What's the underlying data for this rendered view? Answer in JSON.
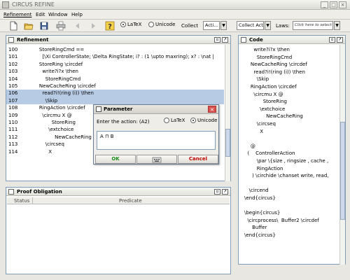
{
  "window": {
    "title": "CIRCUS REFINE"
  },
  "menu": [
    "Refinement",
    "Edit",
    "Window",
    "Help"
  ],
  "toolbar": {
    "latex_label": "LaTeX",
    "unicode_label": "Unicode",
    "selected_encoding": "LaTeX",
    "collect_label": "Collect",
    "action_combo": "Acti...",
    "collect_action_combo": "Collect Act...",
    "laws_label": "Laws:",
    "laws_placeholder": "Click here to select"
  },
  "refinement_panel": {
    "title": "Refinement",
    "lines": [
      {
        "num": "100",
        "text": "    StoreRingCmd =="
      },
      {
        "num": "101",
        "text": "      [\\Xi ControllerState; \\Delta RingState; i? : (1 \\upto maxring); x? : \\nat |"
      },
      {
        "num": "102",
        "text": "    StoreRing \\circdef"
      },
      {
        "num": "103",
        "text": "      write?i?x \\then"
      },
      {
        "num": "104",
        "text": "        StoreRingCmd"
      },
      {
        "num": "105",
        "text": "    NewCacheRing \\circdef"
      },
      {
        "num": "106",
        "text": "      read?i!(ring (i)) \\then"
      },
      {
        "num": "107",
        "text": "        \\Skip"
      },
      {
        "num": "108",
        "text": "    RingAction \\circdef"
      },
      {
        "num": "109",
        "text": "      \\circmu X @"
      },
      {
        "num": "110",
        "text": "            StoreRing"
      },
      {
        "num": "111",
        "text": "          \\extchoice"
      },
      {
        "num": "112",
        "text": "              NewCacheRing"
      },
      {
        "num": "113",
        "text": "        \\circseq"
      },
      {
        "num": "114",
        "text": "          X"
      }
    ]
  },
  "proof_panel": {
    "title": "Proof Obligation",
    "columns": [
      "Status",
      "Predicate"
    ]
  },
  "code_panel": {
    "title": "Code",
    "lines": [
      "      write?i?x \\then",
      "        StoreRingCmd",
      "    NewCacheRing \\circdef",
      "      read?i!(ring (i)) \\then",
      "        \\Skip",
      "    RingAction \\circdef",
      "      \\circmu X @",
      "            StoreRing",
      "          \\extchoice",
      "              NewCacheRing",
      "        \\circseq",
      "          X",
      "",
      "    @",
      "  (    ControllerAction",
      "        \\par \\{size , ringsize , cache , ",
      "        RingAction",
      "     ) \\circhide \\chanset write, read, ",
      "",
      "   \\circend",
      "\\end{circus}",
      "",
      "\\begin{circus}",
      "  \\circprocess\\  Buffer2 \\circdef",
      "     Buffer",
      "\\end{circus}"
    ]
  },
  "dialog": {
    "title": "Parameter",
    "prompt": "Enter the action: (A2)",
    "latex_label": "LaTeX",
    "unicode_label": "Unicode",
    "selected_encoding": "Unicode",
    "value": "A ⊓ B",
    "ok_label": "OK",
    "cancel_label": "Cancel"
  },
  "colors": {
    "selection": "#b8cbe4",
    "panel_border": "#7f9db9",
    "ok_text": "#1a8a1a",
    "cancel_text": "#c00000",
    "close_button": "#d9534f"
  }
}
